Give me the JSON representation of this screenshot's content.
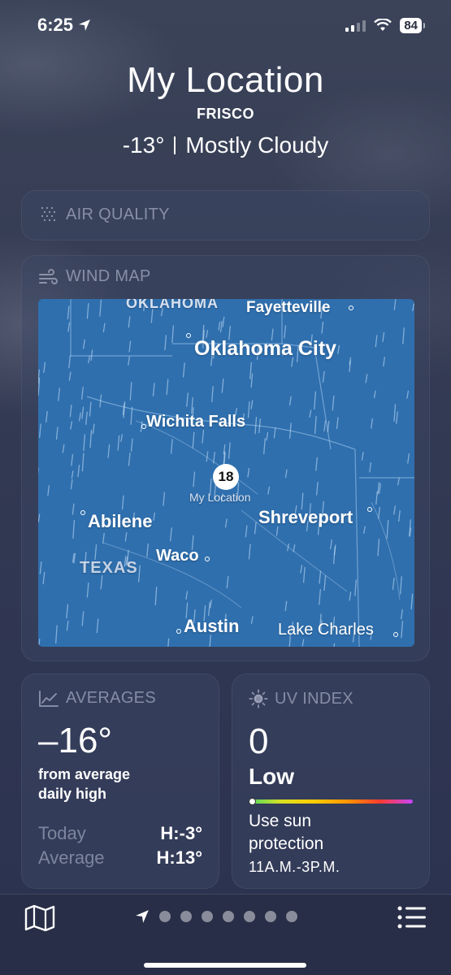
{
  "status_bar": {
    "time": "6:25",
    "battery": "84"
  },
  "header": {
    "title": "My Location",
    "subtitle": "FRISCO",
    "temperature": "-13°",
    "condition": "Mostly Cloudy"
  },
  "air_quality": {
    "title": "AIR QUALITY"
  },
  "wind_map": {
    "title": "WIND MAP",
    "current_wind": "18",
    "current_label": "My Location",
    "cities": [
      "OKLAHOMA",
      "Fayetteville",
      "Oklahoma City",
      "Wichita Falls",
      "Abilene",
      "Shreveport",
      "Waco",
      "TEXAS",
      "Austin",
      "Lake Charles"
    ]
  },
  "averages": {
    "title": "AVERAGES",
    "value": "–16°",
    "desc_line1": "from average",
    "desc_line2": "daily high",
    "rows": [
      {
        "label": "Today",
        "value": "H:-3°"
      },
      {
        "label": "Average",
        "value": "H:13°"
      }
    ]
  },
  "uv_index": {
    "title": "UV INDEX",
    "value": "0",
    "level": "Low",
    "level_fraction": 0,
    "note_line1": "Use sun",
    "note_line2": "protection",
    "hours": "11A.M.-3P.M."
  },
  "bottom_bar": {
    "page_count": 8,
    "current_page": 0
  },
  "colors": {
    "map_water": "#2f6fae",
    "background": "#353c54"
  }
}
